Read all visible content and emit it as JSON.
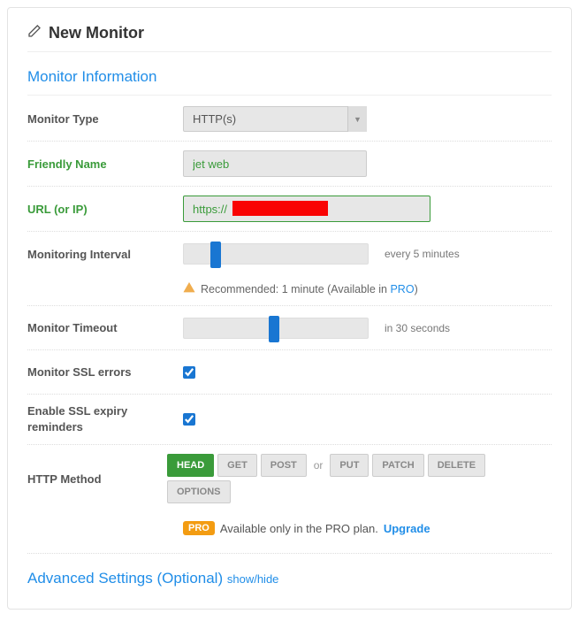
{
  "title": "New Monitor",
  "section": "Monitor Information",
  "fields": {
    "monitor_type": {
      "label": "Monitor Type",
      "value": "HTTP(s)"
    },
    "friendly_name": {
      "label": "Friendly Name",
      "value": "jet web"
    },
    "url": {
      "label": "URL (or IP)",
      "value": "https://"
    },
    "interval": {
      "label": "Monitoring Interval",
      "display": "every 5 minutes"
    },
    "recommend": {
      "text": "Recommended: 1 minute (Available in ",
      "link": "PRO",
      "after": ")"
    },
    "timeout": {
      "label": "Monitor Timeout",
      "display": "in 30 seconds"
    },
    "ssl_errors": {
      "label": "Monitor SSL errors"
    },
    "ssl_expiry": {
      "label": "Enable SSL expiry reminders"
    },
    "http_method": {
      "label": "HTTP Method"
    }
  },
  "methods": [
    "HEAD",
    "GET",
    "POST"
  ],
  "methods_or": "or",
  "methods2": [
    "PUT",
    "PATCH",
    "DELETE",
    "OPTIONS"
  ],
  "pro": {
    "badge": "PRO",
    "text": "Available only in the PRO plan.",
    "link": "Upgrade"
  },
  "advanced": {
    "title": "Advanced Settings (Optional)",
    "toggle": "show/hide"
  }
}
